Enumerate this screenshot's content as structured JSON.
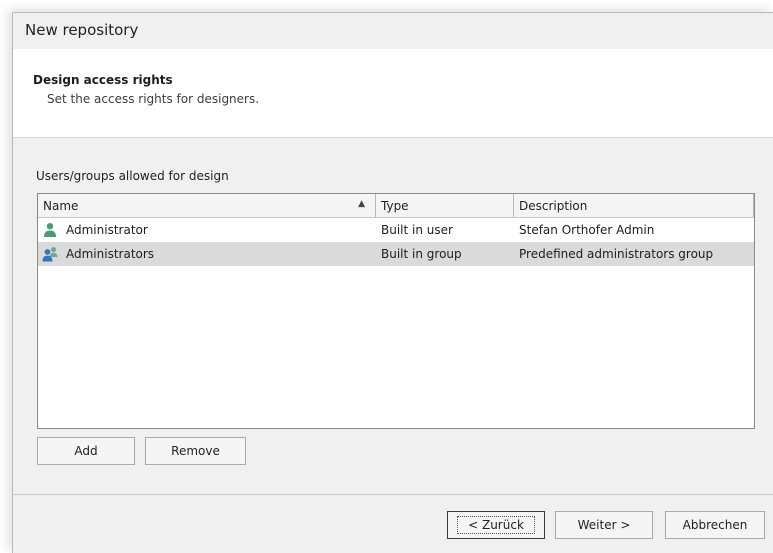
{
  "window": {
    "title": "New repository"
  },
  "header": {
    "title": "Design access rights",
    "subtitle": "Set the access rights for designers."
  },
  "group_label": "Users/groups allowed for design",
  "grid": {
    "columns": [
      {
        "label": "Name",
        "sorted": "ascending"
      },
      {
        "label": "Type"
      },
      {
        "label": "Description"
      }
    ],
    "rows": [
      {
        "name": "Administrator",
        "type": "Built in user",
        "description": "Stefan Orthofer Admin",
        "icon": "user-icon",
        "selected": false
      },
      {
        "name": "Administrators",
        "type": "Built in group",
        "description": "Predefined administrators group",
        "icon": "group-icon",
        "selected": true
      }
    ]
  },
  "buttons": {
    "add": "Add",
    "remove": "Remove",
    "back": "< Zurück",
    "next": "Weiter >",
    "cancel": "Abbrechen"
  },
  "colors": {
    "user_icon_green": "#4f9a6e",
    "group_icon_blue": "#3e6fb8",
    "selected_row": "#dadada"
  }
}
